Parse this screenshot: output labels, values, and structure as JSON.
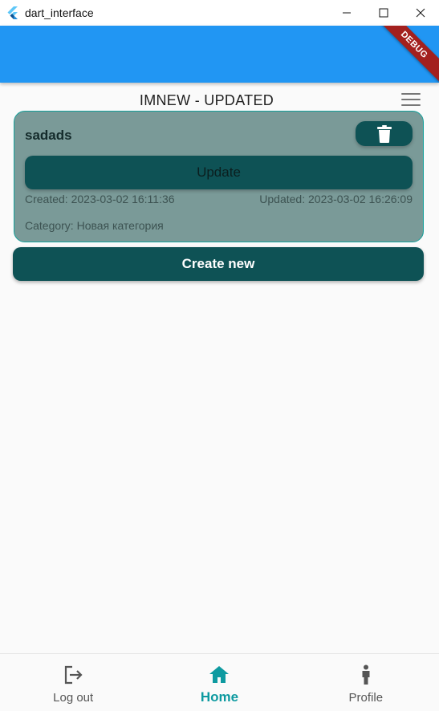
{
  "window": {
    "title": "dart_interface"
  },
  "debug_banner": "DEBUG",
  "header": {
    "title": "IMNEW  - UPDATED"
  },
  "card": {
    "title": "sadads",
    "update_label": "Update",
    "created": "Created: 2023-03-02 16:11:36",
    "updated": "Updated: 2023-03-02 16:26:09",
    "category": "Category: Новая категория"
  },
  "create_new_label": "Create new",
  "bottom_nav": {
    "items": [
      {
        "label": "Log out",
        "icon": "logout-icon"
      },
      {
        "label": "Home",
        "icon": "home-icon",
        "active": true
      },
      {
        "label": "Profile",
        "icon": "person-icon"
      }
    ]
  },
  "colors": {
    "appbar": "#2196f3",
    "card_bg": "#7a9a98",
    "card_border": "#14a09a",
    "button": "#0e5255",
    "active_nav": "#0e9aa0",
    "debug_ribbon": "#a3201e"
  }
}
